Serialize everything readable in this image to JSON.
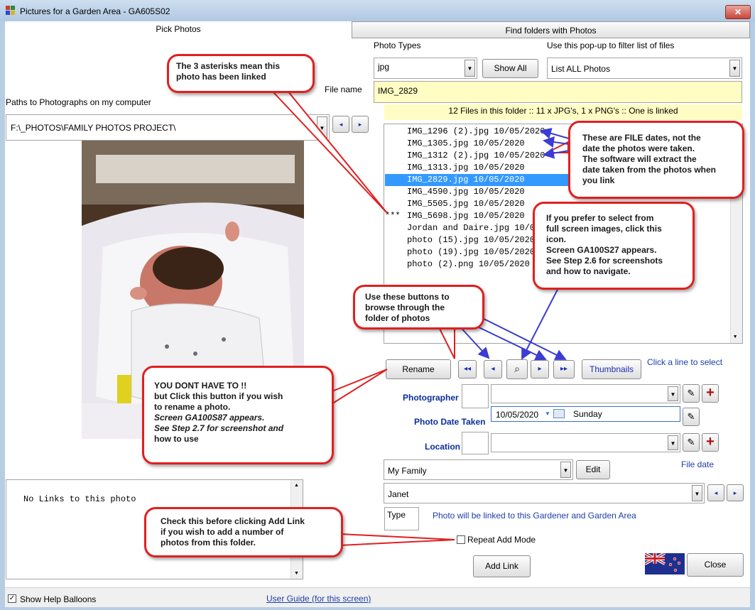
{
  "window": {
    "title": "Pictures for a Garden Area - GA605S02",
    "close_glyph": "✕"
  },
  "tabs": {
    "pick_photos": "Pick Photos",
    "find_folders": "Find folders with Photos"
  },
  "left": {
    "paths_label": "Paths to Photographs on my computer",
    "path_value": "F:\\_PHOTOS\\FAMILY PHOTOS PROJECT\\",
    "links_text": "No Links to this photo"
  },
  "right": {
    "photo_types_label": "Photo Types",
    "photo_type_value": "jpg",
    "show_all": "Show All",
    "filter_label": "Use this pop-up to filter list of files",
    "filter_value": "List ALL Photos",
    "file_name_label": "File name",
    "file_name_value": "IMG_2829",
    "files_summary": "12 Files in this folder :: 11 x JPG's, 1 x PNG's :: One is linked",
    "files": [
      {
        "mark": "",
        "text": "IMG_1296 (2).jpg 10/05/2020",
        "selected": false
      },
      {
        "mark": "",
        "text": "IMG_1305.jpg 10/05/2020",
        "selected": false
      },
      {
        "mark": "",
        "text": "IMG_1312 (2).jpg 10/05/2020",
        "selected": false
      },
      {
        "mark": "",
        "text": "IMG_1313.jpg 10/05/2020",
        "selected": false
      },
      {
        "mark": "",
        "text": "IMG_2829.jpg 10/05/2020",
        "selected": true
      },
      {
        "mark": "",
        "text": "IMG_4590.jpg 10/05/2020",
        "selected": false
      },
      {
        "mark": "",
        "text": "IMG_5505.jpg 10/05/2020",
        "selected": false
      },
      {
        "mark": "***",
        "text": "IMG_5698.jpg 10/05/2020",
        "selected": false
      },
      {
        "mark": "",
        "text": "Jordan and Daire.jpg 10/05/2020",
        "selected": false
      },
      {
        "mark": "",
        "text": "photo (15).jpg 10/05/2020",
        "selected": false
      },
      {
        "mark": "",
        "text": "photo (19).jpg 10/05/2020",
        "selected": false
      },
      {
        "mark": "",
        "text": "photo (2).png 10/05/2020",
        "selected": false
      }
    ],
    "rename": "Rename",
    "thumbnails": "Thumbnails",
    "click_line": "Click a line to select",
    "photographer_label": "Photographer",
    "date_taken_label": "Photo Date Taken",
    "date_value": "10/05/2020",
    "day_value": "Sunday",
    "location_label": "Location",
    "family_value": "My Family",
    "edit": "Edit",
    "file_date": "File date",
    "gardener_value": "Janet",
    "type_label": "Type",
    "linked_note": "Photo will be linked to this Gardener and Garden Area",
    "repeat_add": "Repeat Add Mode",
    "add_link": "Add Link",
    "close": "Close"
  },
  "status": {
    "show_help": "Show Help Balloons",
    "user_guide": "User Guide (for this screen)"
  },
  "balloons": {
    "asterisks": [
      "The 3 asterisks mean this",
      "photo has been linked"
    ],
    "file_dates": [
      "These are FILE dates, not the",
      "date the photos were taken.",
      "The software will extract the",
      "date taken from the photos when",
      "you link"
    ],
    "full_screen": [
      "If you prefer to select from",
      "full screen images, click this",
      "icon.",
      "Screen GA100S27 appears.",
      "See Step 2.6 for screenshots",
      "and how to navigate."
    ],
    "browse": [
      "Use these buttons to",
      "browse through the",
      "folder of photos"
    ],
    "rename_help": [
      "YOU DONT HAVE TO !!",
      "but Click this button if you wish",
      "to rename a photo.",
      "Screen GA100S87 appears.",
      "See Step 2.7 for screenshot and",
      "how to use"
    ],
    "repeat_help": [
      "Check this before clicking Add Link",
      "if you wish to add a number of",
      "photos from this folder."
    ]
  },
  "icons": {
    "dropdown": "▼",
    "first": "◂◂",
    "prev": "◂",
    "next": "▸",
    "last": "▸▸",
    "pencil": "✎",
    "plus": "+",
    "check": "✓",
    "preview": "⌕"
  },
  "colors": {
    "accent_red": "#e02020",
    "arrow_blue": "#3b3bd6",
    "selection": "#3399ff",
    "label_blue": "#0a2d9c"
  }
}
